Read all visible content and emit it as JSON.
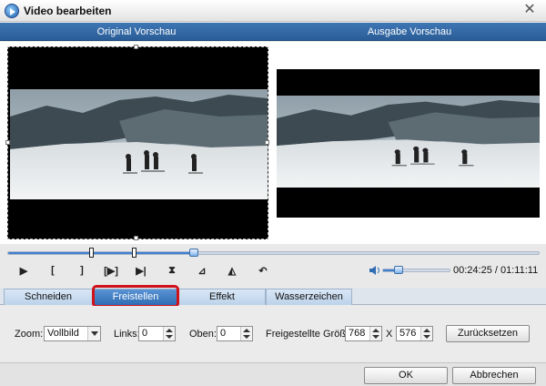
{
  "window": {
    "title": "Video bearbeiten",
    "close_glyph": "✕"
  },
  "preview": {
    "original_label": "Original Vorschau",
    "output_label": "Ausgabe Vorschau"
  },
  "playback": {
    "progress_fraction": 0.35,
    "trim_start_fraction": 0.157,
    "trim_end_fraction": 0.238,
    "volume_fraction": 0.22,
    "time_current": "00:24:25",
    "time_separator": "/",
    "time_total": "01:11:11",
    "controls": [
      {
        "name": "play-icon",
        "glyph": "▶"
      },
      {
        "name": "mark-in-icon",
        "glyph": "["
      },
      {
        "name": "mark-out-icon",
        "glyph": "]"
      },
      {
        "name": "play-segment-icon",
        "glyph": "[▶]"
      },
      {
        "name": "step-icon",
        "glyph": "▶|"
      },
      {
        "name": "split-icon",
        "glyph": "⧗"
      },
      {
        "name": "rotate-left-icon",
        "glyph": "⊿"
      },
      {
        "name": "rotate-right-icon",
        "glyph": "◭"
      },
      {
        "name": "undo-icon",
        "glyph": "↶"
      }
    ]
  },
  "tabs": [
    {
      "label": "Schneiden",
      "active": false
    },
    {
      "label": "Freistellen",
      "active": true
    },
    {
      "label": "Effekt",
      "active": false
    },
    {
      "label": "Wasserzeichen",
      "active": false
    }
  ],
  "crop": {
    "zoom_label": "Zoom:",
    "zoom_value": "Vollbild",
    "left_label": "Links:",
    "left_value": "0",
    "top_label": "Oben:",
    "top_value": "0",
    "size_label": "Freigestellte Größe:",
    "width_value": "768",
    "x_label": "X",
    "height_value": "576",
    "reset_label": "Zurücksetzen"
  },
  "footer": {
    "ok_label": "OK",
    "cancel_label": "Abbrechen"
  },
  "colors": {
    "accent": "#2f6cb4",
    "highlight": "#d0121b"
  }
}
